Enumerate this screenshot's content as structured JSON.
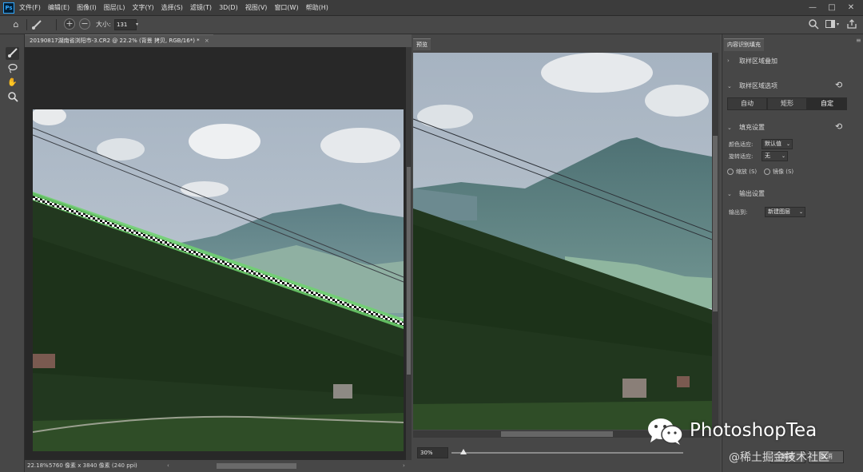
{
  "app": {
    "logo": "Ps",
    "menu": [
      "文件(F)",
      "编辑(E)",
      "图像(I)",
      "图层(L)",
      "文字(Y)",
      "选择(S)",
      "滤镜(T)",
      "3D(D)",
      "视图(V)",
      "窗口(W)",
      "帮助(H)"
    ],
    "window_controls": [
      "—",
      "□",
      "✕"
    ]
  },
  "options_bar": {
    "size_label": "大小:",
    "size_value": "131"
  },
  "tools": [
    "brush-tool",
    "lasso-tool",
    "hand-tool",
    "zoom-tool"
  ],
  "document": {
    "tab_title": "20190817湖南省浏阳市-3.CR2 @ 22.2% (背景 拷贝, RGB/16*) *",
    "status_zoom": "22.18%",
    "status_info": "5760 像素 x 3840 像素 (240 ppi)"
  },
  "preview": {
    "tab_label": "预览",
    "zoom": "30%",
    "zoom_fraction": 0.05
  },
  "panel": {
    "tab_label": "内容识别填充",
    "sampling_overlay": "取样区域叠加",
    "sampling_options": "取样区域选项",
    "modes": [
      "自动",
      "矩形",
      "自定"
    ],
    "active_mode": "自定",
    "fill_settings": "填充设置",
    "color_adapt_label": "颜色适应:",
    "color_adapt_value": "默认值",
    "rotation_adapt_label": "旋转适应:",
    "rotation_adapt_value": "无",
    "scale_label": "缩放 (S)",
    "mirror_label": "镜像 (S)",
    "output_settings": "输出设置",
    "output_to_label": "输出到:",
    "output_to_value": "新建图层",
    "btn_ok": "确定",
    "btn_cancel": "取消"
  },
  "watermark": {
    "brand": "PhotoshopTea",
    "site": "@稀土掘金技术社区"
  },
  "colors": {
    "app_bg": "#535353",
    "panel_bg": "#474747",
    "overlay_green": "#6fd36f"
  }
}
